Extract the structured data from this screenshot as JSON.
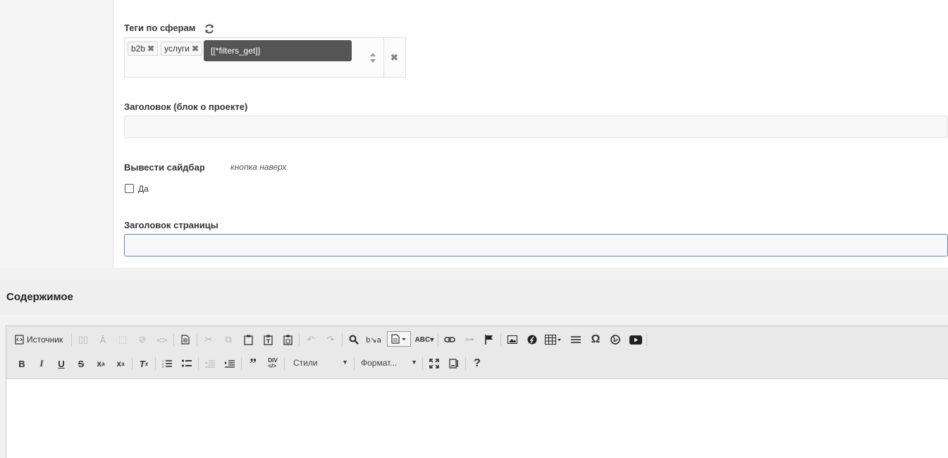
{
  "fields": {
    "tags_label": "Теги по сферам",
    "tags": [
      {
        "label": "b2b"
      },
      {
        "label": "услуги"
      }
    ],
    "tooltip": "[[*filters_get]]",
    "project_heading_label": "Заголовок (блок о проекте)",
    "project_heading_value": "",
    "sidebar_label": "Вывести сайдбар",
    "sidebar_hint": "кнопка наверх",
    "sidebar_option": "Да",
    "page_title_label": "Заголовок страницы",
    "page_title_value": ""
  },
  "content": {
    "title": "Содержимое",
    "toolbar": {
      "source_label": "Источник",
      "styles_label": "Стили",
      "format_label": "Формат..."
    }
  },
  "icons": [
    "refresh-icon",
    "close-icon",
    "sort-updown-icon",
    "checkbox-icon"
  ]
}
